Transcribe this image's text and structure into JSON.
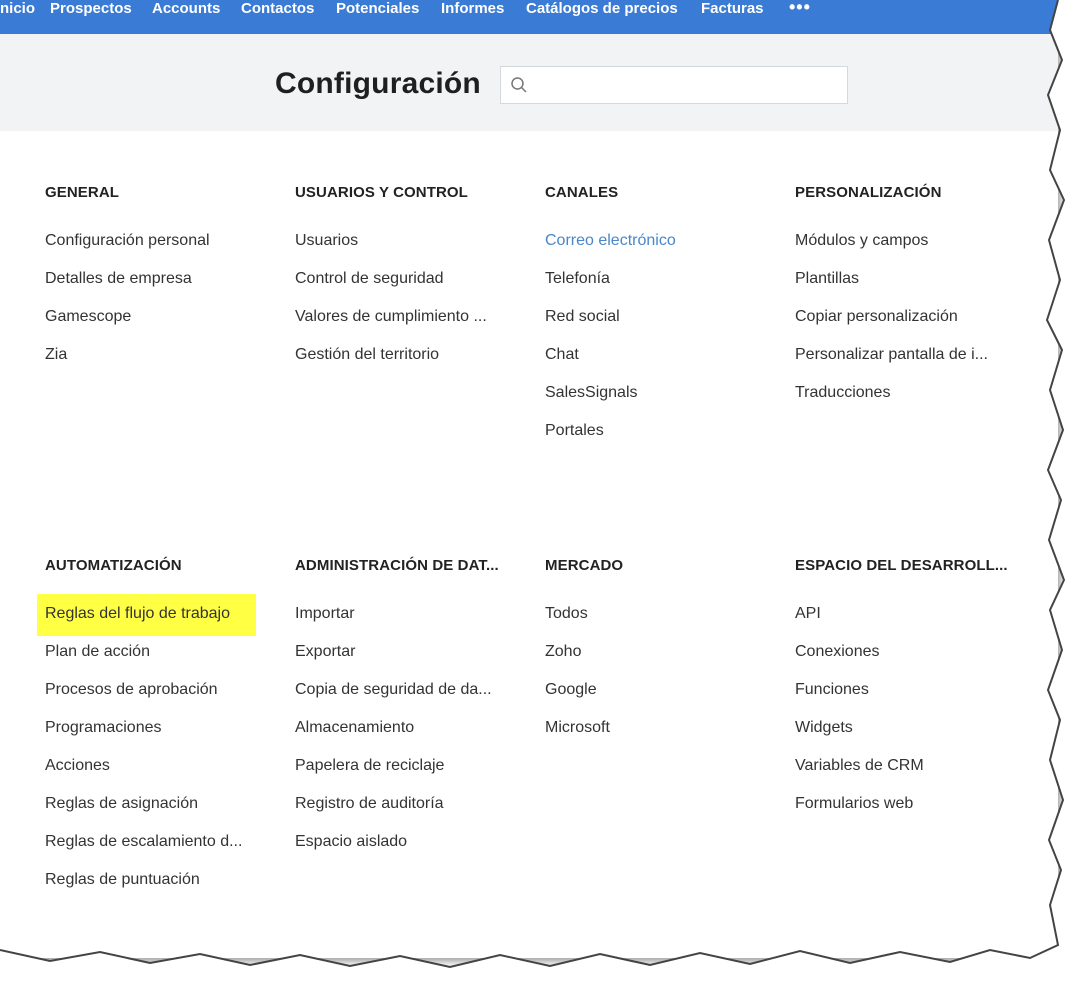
{
  "nav": {
    "items": [
      "nicio",
      "Prospectos",
      "Accounts",
      "Contactos",
      "Potenciales",
      "Informes",
      "Catálogos de precios",
      "Facturas"
    ],
    "more": "•••"
  },
  "header": {
    "title": "Configuración",
    "search_placeholder": ""
  },
  "sections": {
    "general": {
      "title": "GENERAL",
      "items": [
        "Configuración personal",
        "Detalles de empresa",
        "Gamescope",
        "Zia"
      ]
    },
    "usuarios": {
      "title": "USUARIOS Y CONTROL",
      "items": [
        "Usuarios",
        "Control de seguridad",
        "Valores de cumplimiento ...",
        "Gestión del territorio"
      ]
    },
    "canales": {
      "title": "CANALES",
      "items": [
        "Correo electrónico",
        "Telefonía",
        "Red social",
        "Chat",
        "SalesSignals",
        "Portales"
      ]
    },
    "personalizacion": {
      "title": "PERSONALIZACIÓN",
      "items": [
        "Módulos y campos",
        "Plantillas",
        "Copiar personalización",
        "Personalizar pantalla de i...",
        "Traducciones"
      ]
    },
    "automatizacion": {
      "title": "AUTOMATIZACIÓN",
      "items": [
        "Reglas del flujo de trabajo",
        "Plan de acción",
        "Procesos de aprobación",
        "Programaciones",
        "Acciones",
        "Reglas de asignación",
        "Reglas de escalamiento d...",
        "Reglas de puntuación"
      ]
    },
    "administracion": {
      "title": "ADMINISTRACIÓN DE DAT...",
      "items": [
        "Importar",
        "Exportar",
        "Copia de seguridad de da...",
        "Almacenamiento",
        "Papelera de reciclaje",
        "Registro de auditoría",
        "Espacio aislado"
      ]
    },
    "mercado": {
      "title": "MERCADO",
      "items": [
        "Todos",
        "Zoho",
        "Google",
        "Microsoft"
      ]
    },
    "desarrollo": {
      "title": "ESPACIO DEL DESARROLL...",
      "items": [
        "API",
        "Conexiones",
        "Funciones",
        "Widgets",
        "Variables de CRM",
        "Formularios web"
      ]
    }
  },
  "colors": {
    "nav_bg": "#3a7bd5",
    "active_link": "#4a86c8",
    "highlight": "#ffff44"
  }
}
